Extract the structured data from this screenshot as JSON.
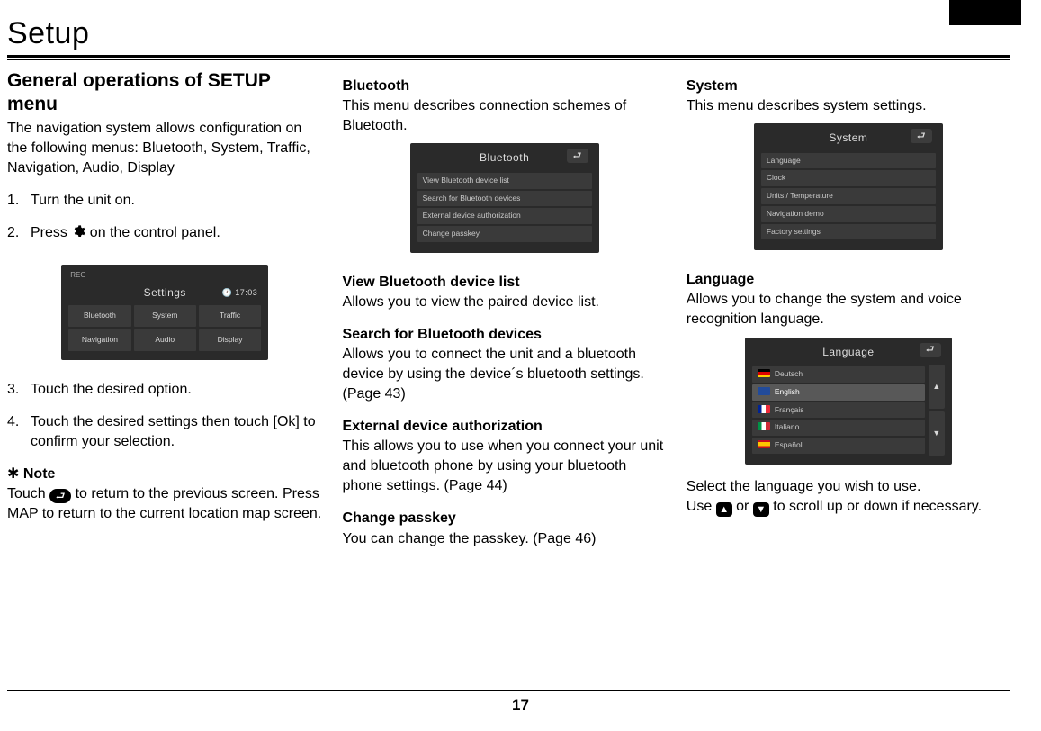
{
  "page": {
    "title": "Setup",
    "number": "17"
  },
  "col1": {
    "heading": "General operations of SETUP menu",
    "intro": "The navigation system allows configuration on the following menus: Bluetooth, System, Traffic, Navigation, Audio, Display",
    "steps": {
      "s1": "Turn the unit on.",
      "s2a": "Press ",
      "s2b": " on the control panel.",
      "s3": "Touch the desired option.",
      "s4": "Touch the desired settings then touch [Ok] to confirm your selection."
    },
    "note_label": "Note",
    "note_a": "Touch ",
    "note_b": " to return to the previous screen. Press MAP to return to the current location map screen.",
    "shot": {
      "topleft": "REG",
      "time": "17:03",
      "title": "Settings",
      "tiles": [
        "Bluetooth",
        "System",
        "Traffic",
        "Navigation",
        "Audio",
        "Display"
      ]
    }
  },
  "col2": {
    "heading": "Bluetooth",
    "intro": "This menu describes connection schemes of Bluetooth.",
    "shot": {
      "title": "Bluetooth",
      "rows": [
        "View Bluetooth device list",
        "Search for Bluetooth devices",
        "External device authorization",
        "Change passkey"
      ]
    },
    "items": {
      "h1": "View Bluetooth device list",
      "d1": "Allows you to view the paired device list.",
      "h2": "Search for Bluetooth devices",
      "d2": "Allows you to connect the unit and a bluetooth device by using the device´s bluetooth settings. (Page 43)",
      "h3": "External device authorization",
      "d3": "This allows you to use when you connect your unit and bluetooth phone by using your bluetooth phone settings. (Page 44)",
      "h4": "Change passkey",
      "d4": "You can change the passkey. (Page 46)"
    }
  },
  "col3": {
    "heading": "System",
    "intro": "This menu describes system settings.",
    "shot_system": {
      "title": "System",
      "rows": [
        "Language",
        "Clock",
        "Units / Temperature",
        "Navigation demo",
        "Factory settings"
      ]
    },
    "lang_heading": "Language",
    "lang_desc": "Allows you to change the system and voice recognition language.",
    "shot_language": {
      "title": "Language",
      "rows": [
        "Deutsch",
        "English",
        "Français",
        "Italiano",
        "Español"
      ]
    },
    "lang_instr1": "Select the language you wish to use.",
    "lang_instr2a": "Use ",
    "lang_instr2b": " or ",
    "lang_instr2c": " to scroll up or down if necessary."
  }
}
